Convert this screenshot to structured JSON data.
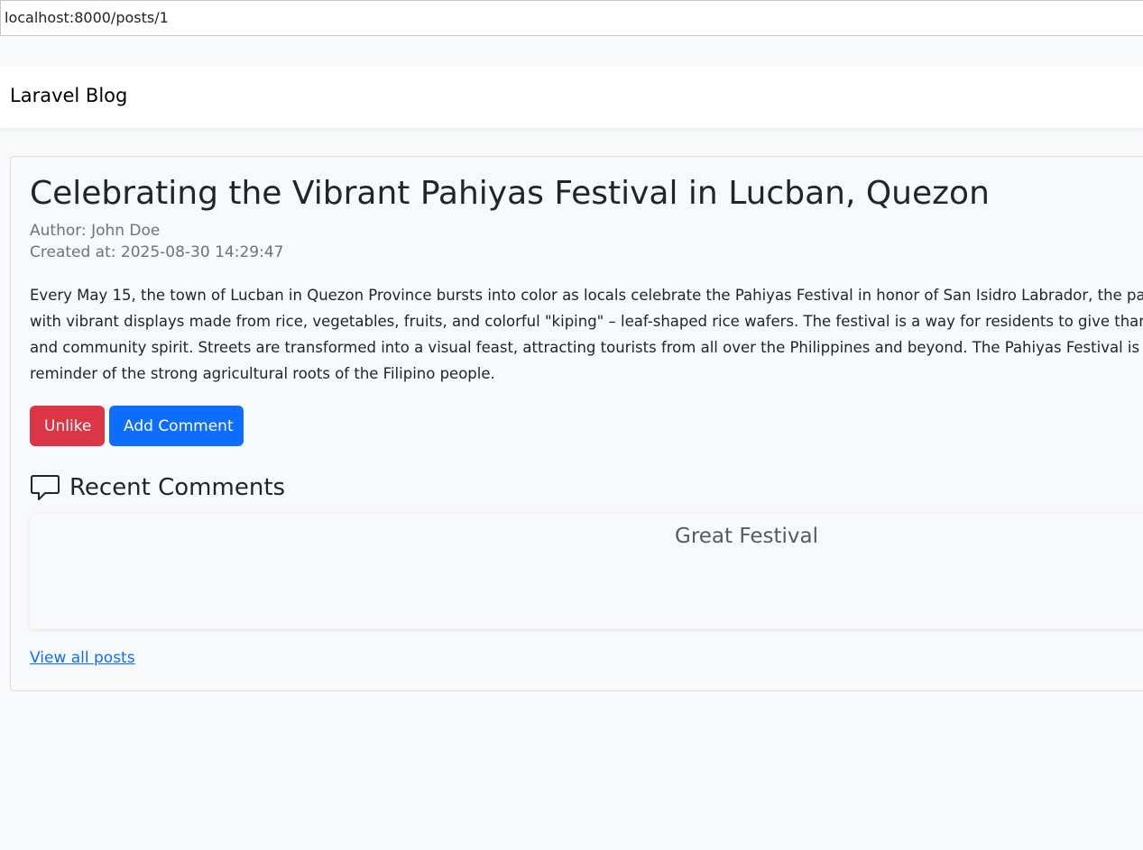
{
  "browser": {
    "url": "localhost:8000/posts/1"
  },
  "navbar": {
    "brand": "Laravel Blog"
  },
  "post": {
    "title": "Celebrating the Vibrant Pahiyas Festival in Lucban, Quezon",
    "author": "Author: John Doe",
    "created_at": "Created at: 2025-08-30 14:29:47",
    "body_lines": [
      "Every May 15, the town of Lucban in Quezon Province bursts into color as locals celebrate the Pahiyas Festival in honor of San Isidro Labrador, the patron",
      "with vibrant displays made from rice, vegetables, fruits, and colorful \"kiping\" – leaf-shaped rice wafers. The festival is a way for residents to give thanks fo",
      "and community spirit. Streets are transformed into a visual feast, attracting tourists from all over the Philippines and beyond. The Pahiyas Festival is not o",
      "reminder of the strong agricultural roots of the Filipino people."
    ]
  },
  "actions": {
    "unlike_label": "Unlike",
    "add_comment_label": "Add Comment"
  },
  "comments": {
    "heading": "Recent Comments",
    "icon": "chat-icon",
    "items": [
      {
        "text": "Great Festival"
      }
    ]
  },
  "footer": {
    "view_all_label": "View all posts"
  },
  "colors": {
    "danger": "#dc3545",
    "primary": "#0d6efd",
    "background": "#f8f9fa"
  }
}
